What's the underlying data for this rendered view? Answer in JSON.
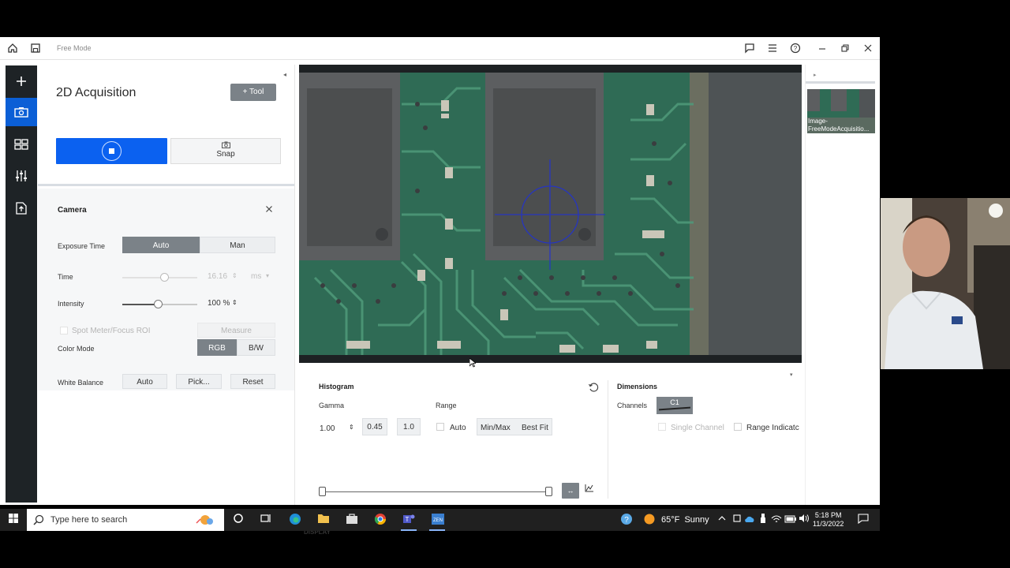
{
  "window": {
    "mode_label": "Free Mode"
  },
  "acquisition": {
    "title": "2D Acquisition",
    "tool_label": "Tool",
    "snap_label": "Snap"
  },
  "camera": {
    "title": "Camera",
    "exposure_label": "Exposure Time",
    "exposure_auto": "Auto",
    "exposure_man": "Man",
    "time_label": "Time",
    "time_value": "16.16",
    "time_unit": "ms",
    "time_slider_fraction": 0.56,
    "intensity_label": "Intensity",
    "intensity_value": "100 %",
    "intensity_slider_fraction": 0.48,
    "spot_meter_label": "Spot Meter/Focus ROI",
    "measure_label": "Measure",
    "color_mode_label": "Color Mode",
    "color_rgb": "RGB",
    "color_bw": "B/W",
    "white_balance_label": "White Balance",
    "wb_auto": "Auto",
    "wb_pick": "Pick...",
    "wb_reset": "Reset"
  },
  "histogram": {
    "title": "Histogram",
    "gamma_label": "Gamma",
    "gamma_value": "1.00",
    "gamma_preset_1": "0.45",
    "gamma_preset_2": "1.0",
    "range_label": "Range",
    "range_auto": "Auto",
    "range_minmax": "Min/Max",
    "range_bestfit": "Best Fit"
  },
  "dimensions": {
    "title": "Dimensions",
    "channels_label": "Channels",
    "channel_c1": "C1",
    "single_channel_label": "Single Channel",
    "range_indicator_label": "Range Indicatc"
  },
  "display_tab": "DISPLAY",
  "gallery": {
    "thumb_label_1": "Image-",
    "thumb_label_2": "FreeModeAcquisitio..."
  },
  "taskbar": {
    "search_placeholder": "Type here to search",
    "weather": "65°F  Sunny",
    "time": "5:18 PM",
    "date": "11/3/2022"
  },
  "colors": {
    "accent": "#0b61f0",
    "sidebar_bg": "#1e2326",
    "segment_on": "#7b8288",
    "pcb_green": "#2f6b55"
  }
}
